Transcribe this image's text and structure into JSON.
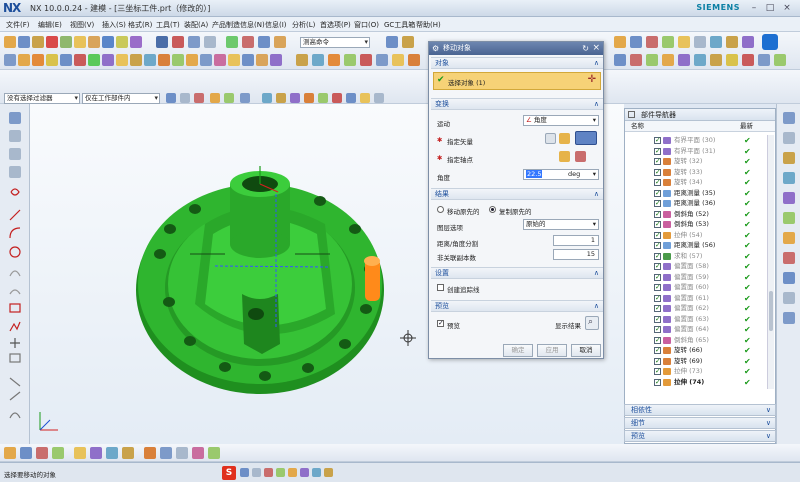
{
  "window": {
    "logo": "NX",
    "title": "NX 10.0.0.24 - 建模 - [三坐标工件.prt（修改的）]",
    "brand": "SIEMENS",
    "controls": [
      "–",
      "□",
      "×"
    ]
  },
  "menu": [
    "文件(F)",
    "编辑(E)",
    "视图(V)",
    "插入(S)",
    "格式(R)",
    "工具(T)",
    "装配(A)",
    "产品制造信息(N)",
    "信息(I)",
    "分析(L)",
    "首选项(P)",
    "窗口(O)",
    "GC工具箱",
    "帮助(H)"
  ],
  "toolbar": {
    "selection_filter": "没有选择过滤器",
    "scope": "仅在工作部件内",
    "search_placeholder": "测高命令"
  },
  "dialog": {
    "title": "移动对象",
    "sections": {
      "object": "对象",
      "transform": "变换",
      "result": "结果",
      "settings": "设置",
      "preview": "预览"
    },
    "select_object": "选择对象 (1)",
    "motion_label": "运动",
    "motion_value": "角度",
    "vector_label": "指定矢量",
    "pivot_label": "指定轴点",
    "angle_label": "角度",
    "angle_value": "22.5",
    "angle_unit": "deg",
    "move_original": "移动原先的",
    "copy_original": "复制原先的",
    "layer_label": "图层选项",
    "layer_value": "原始的",
    "distance_label": "距离/角度分割",
    "distance_value": "1",
    "copies_label": "非关联副本数",
    "copies_value": "15",
    "trace_label": "创建追踪线",
    "preview_label": "预览",
    "show_result": "显示结果",
    "ok": "确定",
    "apply": "应用",
    "cancel": "取消"
  },
  "navigator": {
    "title": "部件导航器",
    "col_name": "名称",
    "col_latest": "最新",
    "rows": [
      {
        "label": "有界平面 (30)",
        "suppressed": true,
        "color": "#8f6fc9"
      },
      {
        "label": "有界平面 (31)",
        "suppressed": true,
        "color": "#8f6fc9"
      },
      {
        "label": "旋转 (32)",
        "suppressed": true,
        "color": "#d9803a"
      },
      {
        "label": "旋转 (33)",
        "suppressed": true,
        "color": "#d9803a"
      },
      {
        "label": "旋转 (34)",
        "suppressed": true,
        "color": "#d9803a"
      },
      {
        "label": "距离测量 (35)",
        "suppressed": false,
        "color": "#6f9fd9"
      },
      {
        "label": "距离测量 (36)",
        "suppressed": false,
        "color": "#6f9fd9"
      },
      {
        "label": "倒斜角 (52)",
        "suppressed": false,
        "color": "#c95f9f"
      },
      {
        "label": "倒斜角 (53)",
        "suppressed": false,
        "color": "#c95f9f"
      },
      {
        "label": "拉伸 (54)",
        "suppressed": true,
        "color": "#e39a3a"
      },
      {
        "label": "距离测量 (56)",
        "suppressed": false,
        "color": "#6f9fd9"
      },
      {
        "label": "求和 (57)",
        "suppressed": true,
        "color": "#4a9a4a"
      },
      {
        "label": "偏置面 (58)",
        "suppressed": true,
        "color": "#8f6fc9"
      },
      {
        "label": "偏置面 (59)",
        "suppressed": true,
        "color": "#8f6fc9"
      },
      {
        "label": "偏置面 (60)",
        "suppressed": true,
        "color": "#8f6fc9"
      },
      {
        "label": "偏置面 (61)",
        "suppressed": true,
        "color": "#8f6fc9"
      },
      {
        "label": "偏置面 (62)",
        "suppressed": true,
        "color": "#8f6fc9"
      },
      {
        "label": "偏置面 (63)",
        "suppressed": true,
        "color": "#8f6fc9"
      },
      {
        "label": "偏置面 (64)",
        "suppressed": true,
        "color": "#8f6fc9"
      },
      {
        "label": "倒斜角 (65)",
        "suppressed": true,
        "color": "#c95f9f"
      },
      {
        "label": "旋转 (66)",
        "suppressed": false,
        "color": "#d9803a"
      },
      {
        "label": "旋转 (69)",
        "suppressed": false,
        "color": "#d9803a"
      },
      {
        "label": "拉伸 (73)",
        "suppressed": true,
        "color": "#e39a3a"
      },
      {
        "label": "拉伸 (74)",
        "suppressed": false,
        "bold": true,
        "color": "#e39a3a"
      }
    ],
    "panels": [
      "相依性",
      "细节",
      "预览"
    ]
  },
  "status": {
    "prompt": "选择要移动的对象"
  },
  "colors": {
    "part": "#2fb52f",
    "accent": "#f6c95a",
    "check": "#1a9a1a"
  }
}
